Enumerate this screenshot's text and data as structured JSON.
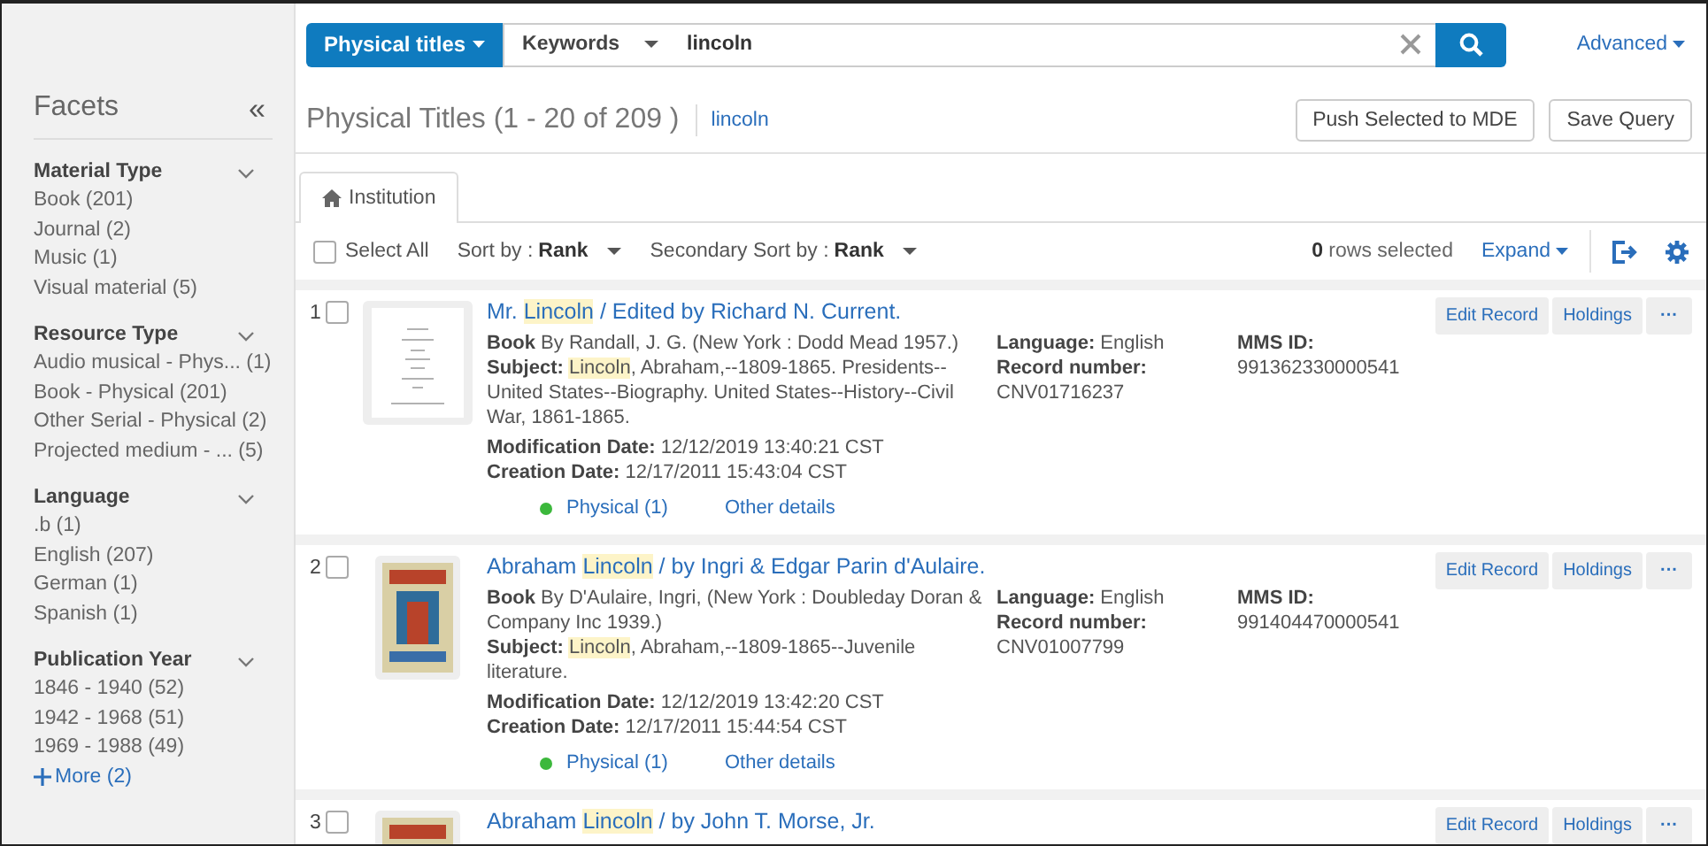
{
  "sidebar": {
    "title": "Facets",
    "collapse_icon": "«",
    "groups": [
      {
        "title": "Material Type",
        "expanded": true,
        "items": [
          {
            "label": "Book",
            "count": "(201)"
          },
          {
            "label": "Journal",
            "count": "(2)"
          },
          {
            "label": "Music",
            "count": "(1)"
          },
          {
            "label": "Visual material",
            "count": "(5)"
          }
        ]
      },
      {
        "title": "Resource Type",
        "expanded": true,
        "items": [
          {
            "label": "Audio musical - Phys...",
            "count": "(1)"
          },
          {
            "label": "Book - Physical",
            "count": "(201)"
          },
          {
            "label": "Other Serial - Physical",
            "count": "(2)"
          },
          {
            "label": "Projected medium - ...",
            "count": "(5)"
          }
        ]
      },
      {
        "title": "Language",
        "expanded": true,
        "items": [
          {
            "label": ".b",
            "count": "(1)"
          },
          {
            "label": "English",
            "count": "(207)"
          },
          {
            "label": "German",
            "count": "(1)"
          },
          {
            "label": "Spanish",
            "count": "(1)"
          }
        ]
      },
      {
        "title": "Publication Year",
        "expanded": true,
        "items": [
          {
            "label": "1846 - 1940",
            "count": "(52)"
          },
          {
            "label": "1942 - 1968",
            "count": "(51)"
          },
          {
            "label": "1969 - 1988",
            "count": "(49)"
          }
        ]
      }
    ],
    "more_link": "More (2)"
  },
  "search": {
    "scope": "Physical titles",
    "field": "Keywords",
    "value": "lincoln",
    "advanced": "Advanced"
  },
  "header": {
    "title": "Physical Titles (1 - 20 of 209 )",
    "query": "lincoln",
    "buttons": [
      "Push Selected to MDE",
      "Save Query"
    ]
  },
  "tabs": [
    {
      "label": "Institution",
      "selected": true
    }
  ],
  "toolbar": {
    "select_all": {
      "label": "Select All",
      "checked": false
    },
    "sort_label": "Sort by :",
    "sort_value": "Rank",
    "secondary_label": "Secondary Sort by :",
    "secondary_value": "Rank",
    "selected_count": "0",
    "selected_text": "rows selected",
    "expand": "Expand"
  },
  "results": [
    {
      "number": "1",
      "checked": false,
      "thumbnail": {
        "kind": "document"
      },
      "title": [
        {
          "text": "Mr. ",
          "highlight": false
        },
        {
          "text": "Lincoln",
          "highlight": true
        },
        {
          "text": " / Edited by Richard N. Current.",
          "highlight": false
        }
      ],
      "format": "Book",
      "author": "By Randall, J. G. (New York : Dodd Mead 1957.)",
      "subject_label": "Subject:",
      "subject": [
        {
          "text": "Lincoln",
          "highlight": true
        },
        {
          "text": ", Abraham,--1809-1865. Presidents--United States--Biography. United States--History--Civil War, 1861-1865.",
          "highlight": false
        }
      ],
      "modification_label": "Modification Date:",
      "modification": "12/12/2019 13:40:21 CST",
      "creation_label": "Creation Date:",
      "creation": "12/17/2011 15:43:04 CST",
      "availability": {
        "text": "Physical (1)",
        "color": "#3cb83c"
      },
      "other_details": "Other details",
      "language_label": "Language:",
      "language": "English",
      "record_label": "Record number:",
      "record": "CNV01716237",
      "mms_label": "MMS ID:",
      "mms": "991362330000541",
      "actions": [
        "Edit Record",
        "Holdings",
        "···"
      ]
    },
    {
      "number": "2",
      "checked": false,
      "thumbnail": {
        "kind": "cover"
      },
      "title": [
        {
          "text": "Abraham ",
          "highlight": false
        },
        {
          "text": "Lincoln",
          "highlight": true
        },
        {
          "text": " / by Ingri & Edgar Parin d'Aulaire.",
          "highlight": false
        }
      ],
      "format": "Book",
      "author": "By D'Aulaire, Ingri, (New York : Doubleday Doran & Company Inc 1939.)",
      "subject_label": "Subject:",
      "subject": [
        {
          "text": "Lincoln",
          "highlight": true
        },
        {
          "text": ", Abraham,--1809-1865--Juvenile literature.",
          "highlight": false
        }
      ],
      "modification_label": "Modification Date:",
      "modification": "12/12/2019 13:42:20 CST",
      "creation_label": "Creation Date:",
      "creation": "12/17/2011 15:44:54 CST",
      "availability": {
        "text": "Physical (1)",
        "color": "#3cb83c"
      },
      "other_details": "Other details",
      "language_label": "Language:",
      "language": "English",
      "record_label": "Record number:",
      "record": "CNV01007799",
      "mms_label": "MMS ID:",
      "mms": "991404470000541",
      "actions": [
        "Edit Record",
        "Holdings",
        "···"
      ]
    },
    {
      "number": "3",
      "checked": false,
      "thumbnail": {
        "kind": "cover"
      },
      "title": [
        {
          "text": "Abraham ",
          "highlight": false
        },
        {
          "text": "Lincoln",
          "highlight": true
        },
        {
          "text": " / by John T. Morse, Jr.",
          "highlight": false
        }
      ],
      "actions": [
        "Edit Record",
        "Holdings",
        "···"
      ]
    }
  ]
}
